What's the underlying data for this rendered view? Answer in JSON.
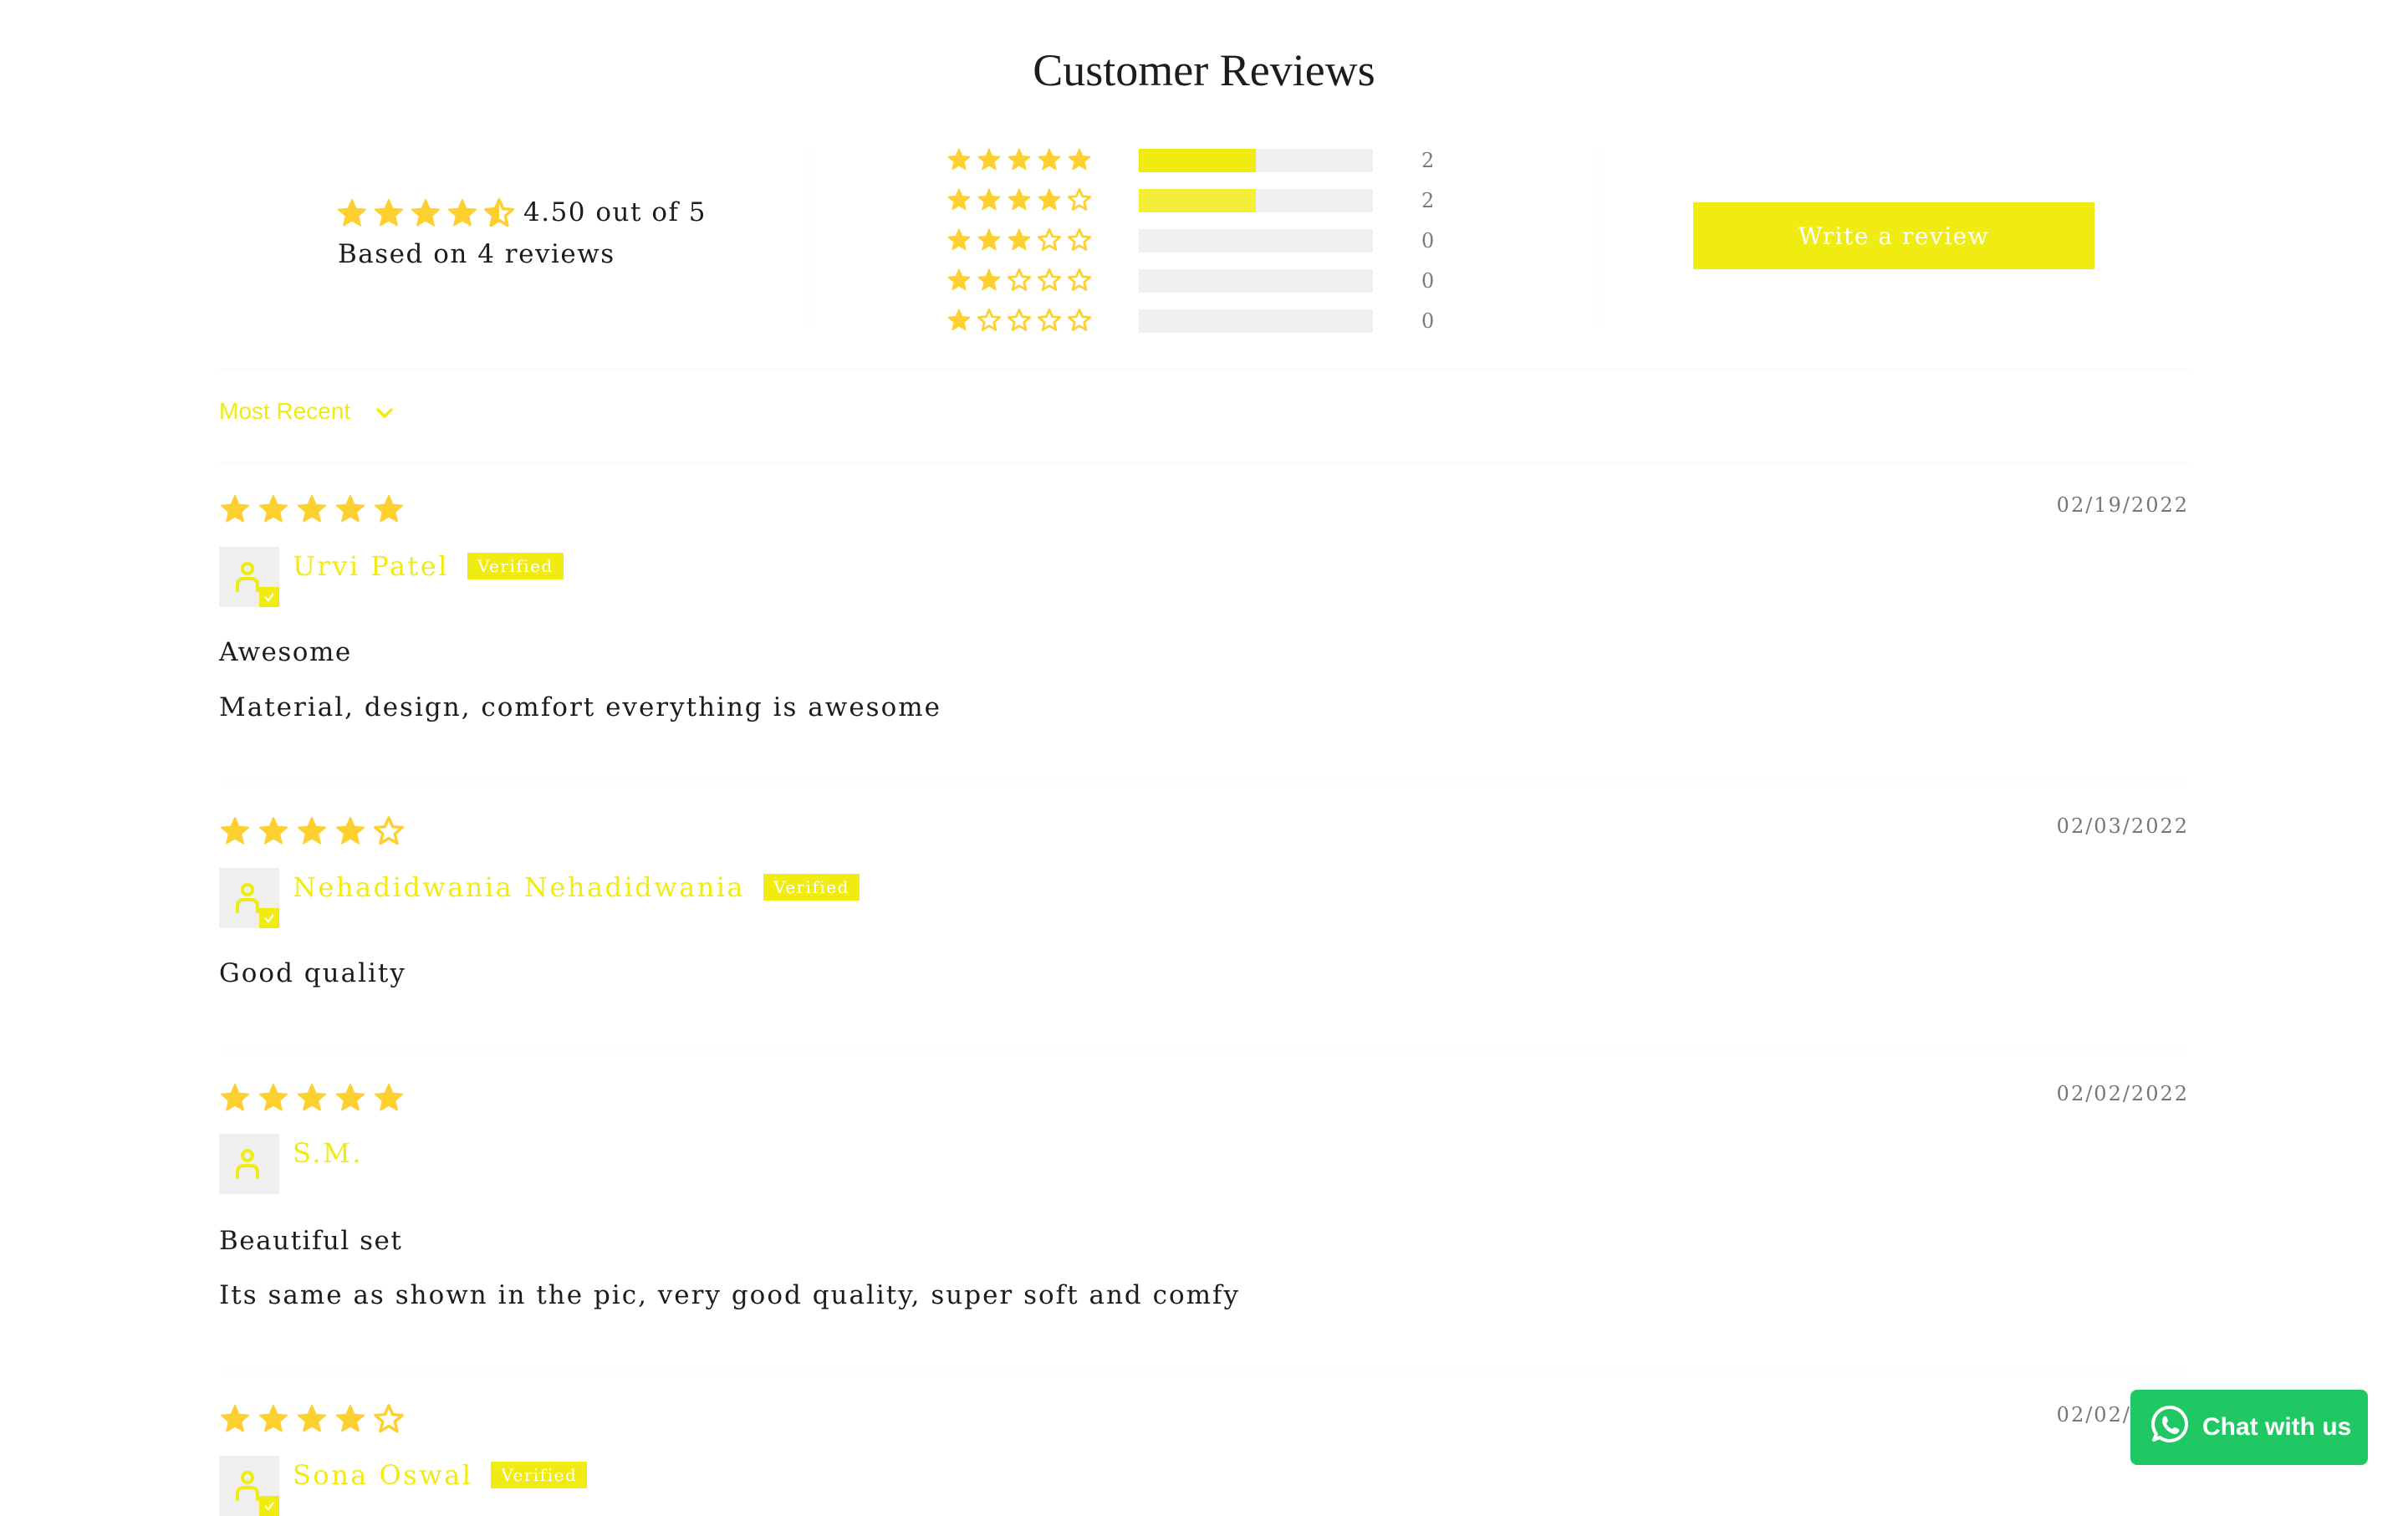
{
  "page": {
    "title": "Customer Reviews"
  },
  "colors": {
    "accent": "#f0ec12",
    "star": "#fdd02f",
    "bar_track": "#efefef",
    "chat_green": "#20c863"
  },
  "summary": {
    "average_rating": 4.5,
    "average_text": "4.50 out of 5",
    "based_on_text": "Based on 4 reviews"
  },
  "histogram": [
    {
      "stars": 5,
      "count": "2",
      "fraction": 0.5
    },
    {
      "stars": 4,
      "count": "2",
      "fraction": 0.5
    },
    {
      "stars": 3,
      "count": "0",
      "fraction": 0
    },
    {
      "stars": 2,
      "count": "0",
      "fraction": 0
    },
    {
      "stars": 1,
      "count": "0",
      "fraction": 0
    }
  ],
  "write_review": {
    "label": "Write a review"
  },
  "sort": {
    "selected": "Most Recent",
    "icon": "chevron-down-icon"
  },
  "reviews": [
    {
      "rating": 5,
      "date": "02/19/2022",
      "name": "Urvi Patel",
      "verified": true,
      "badge": "Verified",
      "title": "Awesome",
      "body": "Material, design, comfort everything is awesome"
    },
    {
      "rating": 4,
      "date": "02/03/2022",
      "name": "Nehadidwania Nehadidwania",
      "verified": true,
      "badge": "Verified",
      "title": "",
      "body": "Good quality"
    },
    {
      "rating": 5,
      "date": "02/02/2022",
      "name": "S.M.",
      "verified": false,
      "badge": "",
      "title": "Beautiful set",
      "body": "Its same as shown in the pic, very good quality, super soft and comfy"
    },
    {
      "rating": 4,
      "date": "02/02/2022",
      "name": "Sona Oswal",
      "verified": true,
      "badge": "Verified",
      "title": "",
      "body": ""
    }
  ],
  "chat": {
    "label": "Chat with us",
    "icon": "whatsapp-icon"
  }
}
